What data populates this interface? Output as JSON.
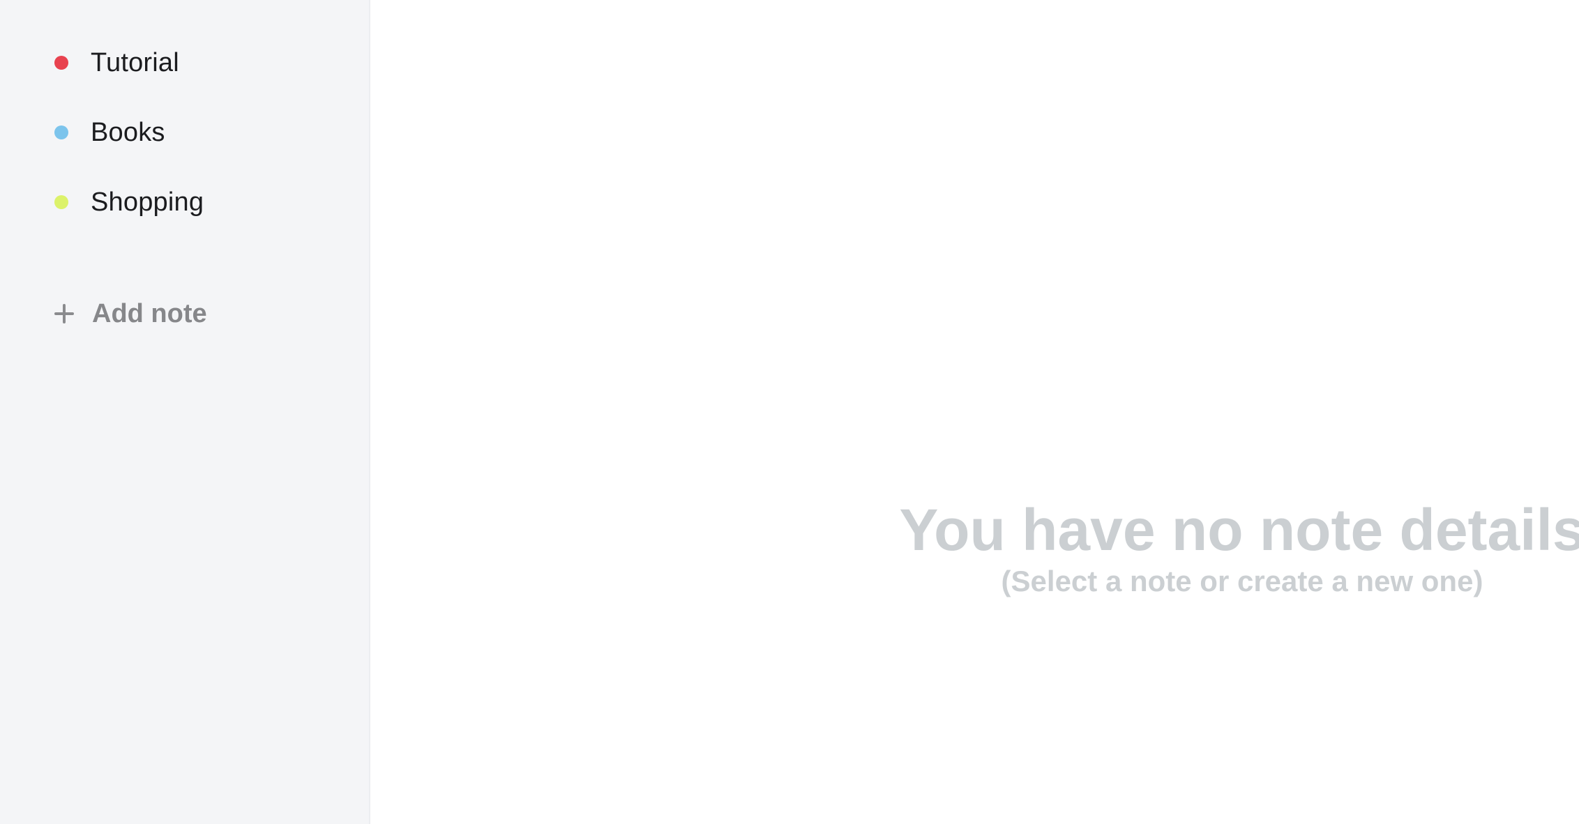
{
  "sidebar": {
    "notes": [
      {
        "label": "Tutorial",
        "color": "#e8424f"
      },
      {
        "label": "Books",
        "color": "#7cc4ec"
      },
      {
        "label": "Shopping",
        "color": "#dcf26a"
      }
    ],
    "add_note_label": "Add note",
    "add_note_icon": "plus-icon"
  },
  "main": {
    "empty_title": "You have no note details",
    "empty_subtitle": "(Select a note or create a new one)"
  }
}
